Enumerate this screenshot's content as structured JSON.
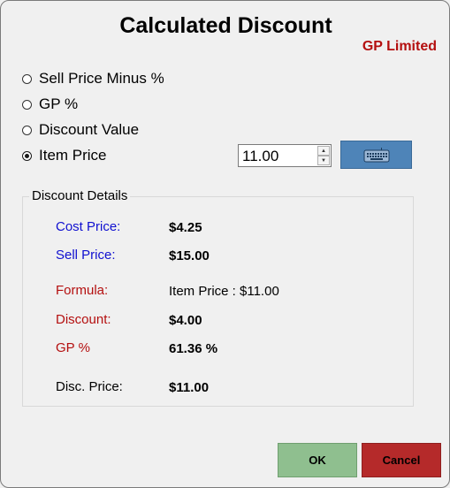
{
  "dialog": {
    "title": "Calculated Discount",
    "company": "GP Limited"
  },
  "options": {
    "sell_price_minus": "Sell Price Minus %",
    "gp_percent": "GP %",
    "discount_value": "Discount Value",
    "item_price": "Item Price",
    "selected": "Item Price"
  },
  "item_price_input": {
    "value": "11.00"
  },
  "keyboard_button": {
    "icon": "keyboard-icon"
  },
  "details": {
    "title": "Discount Details",
    "cost_price_label": "Cost Price:",
    "cost_price_value": "$4.25",
    "sell_price_label": "Sell Price:",
    "sell_price_value": "$15.00",
    "formula_label": "Formula:",
    "formula_value": "Item Price : $11.00",
    "discount_label": "Discount:",
    "discount_value": "$4.00",
    "gp_label": "GP %",
    "gp_value": "61.36 %",
    "disc_price_label": "Disc. Price:",
    "disc_price_value": "$11.00"
  },
  "buttons": {
    "ok": "OK",
    "cancel": "Cancel"
  },
  "colors": {
    "label_blue": "#1010d0",
    "label_red": "#b40f0f",
    "ok_green": "#8fbf8f",
    "cancel_red": "#b52a2a",
    "keyboard_blue": "#4e84b8"
  }
}
